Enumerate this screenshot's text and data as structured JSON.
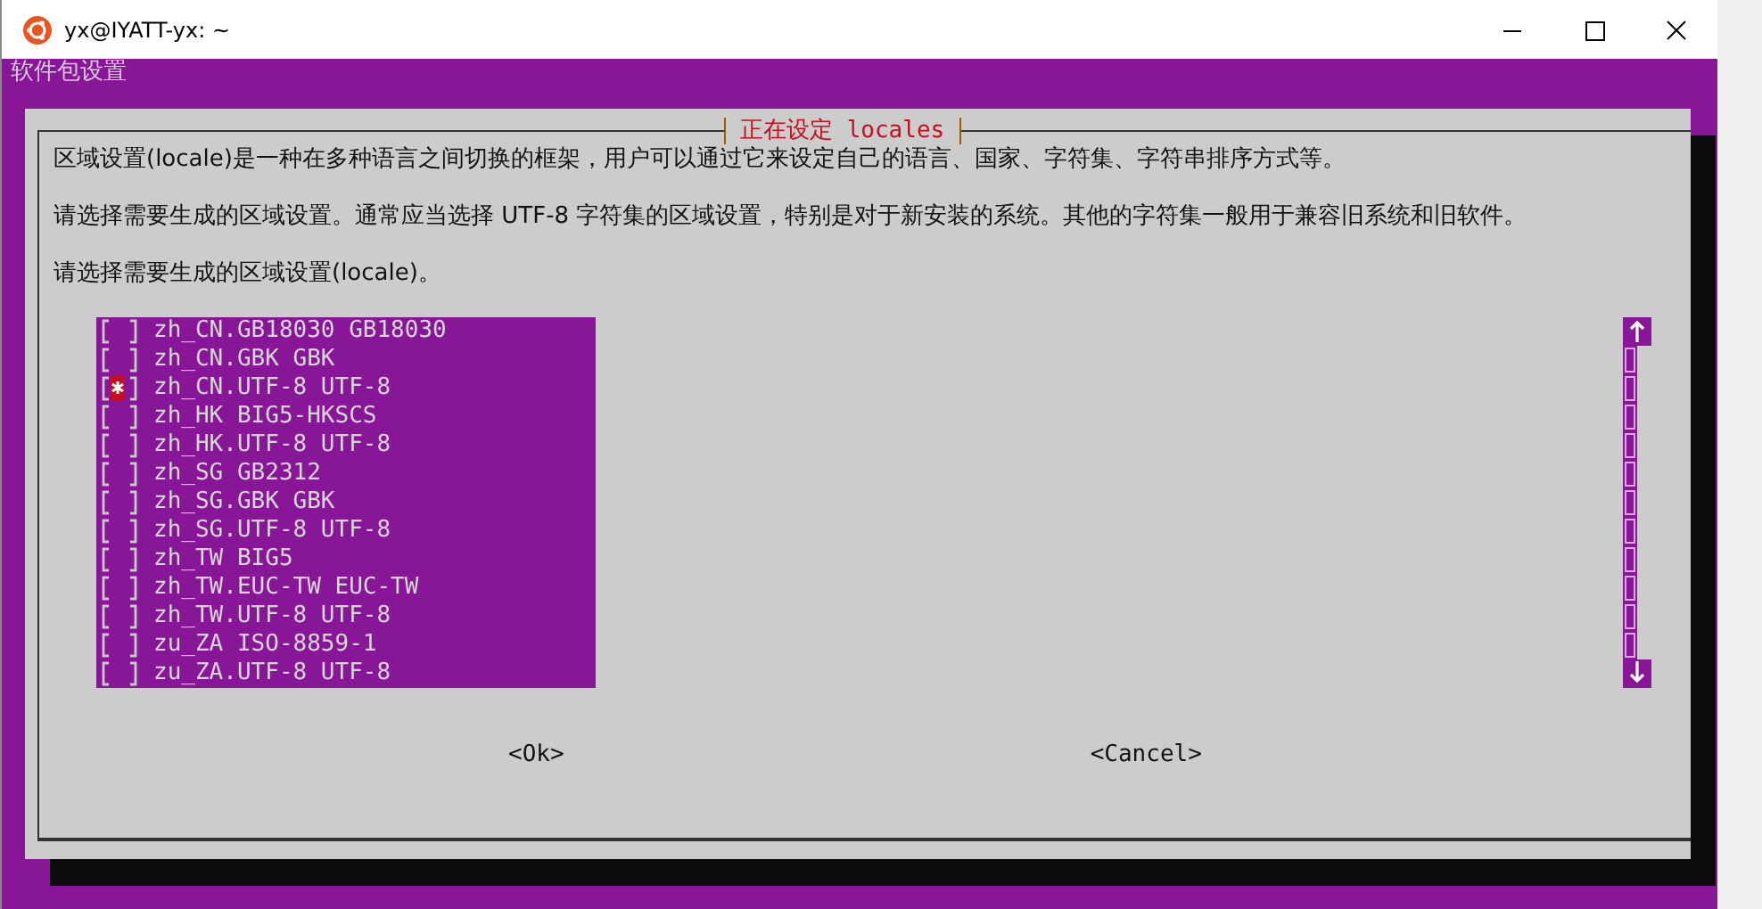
{
  "window": {
    "title": "yx@IYATT-yx: ~"
  },
  "terminal": {
    "header": "软件包设置"
  },
  "dialog": {
    "title": "正在设定 locales",
    "paragraphs": [
      "区域设置(locale)是一种在多种语言之间切换的框架，用户可以通过它来设定自己的语言、国家、字符集、字符串排序方式等。",
      "请选择需要生成的区域设置。通常应当选择 UTF-8 字符集的区域设置，特别是对于新安装的系统。其他的字符集一般用于兼容旧系统和旧软件。",
      "请选择需要生成的区域设置(locale)。"
    ],
    "items": [
      {
        "label": "zh_CN.GB18030 GB18030",
        "checked": false
      },
      {
        "label": "zh_CN.GBK GBK",
        "checked": false
      },
      {
        "label": "zh_CN.UTF-8 UTF-8",
        "checked": true
      },
      {
        "label": "zh_HK BIG5-HKSCS",
        "checked": false
      },
      {
        "label": "zh_HK.UTF-8 UTF-8",
        "checked": false
      },
      {
        "label": "zh_SG GB2312",
        "checked": false
      },
      {
        "label": "zh_SG.GBK GBK",
        "checked": false
      },
      {
        "label": "zh_SG.UTF-8 UTF-8",
        "checked": false
      },
      {
        "label": "zh_TW BIG5",
        "checked": false
      },
      {
        "label": "zh_TW.EUC-TW EUC-TW",
        "checked": false
      },
      {
        "label": "zh_TW.UTF-8 UTF-8",
        "checked": false
      },
      {
        "label": "zu_ZA ISO-8859-1",
        "checked": false
      },
      {
        "label": "zu_ZA.UTF-8 UTF-8",
        "checked": false
      }
    ],
    "buttons": [
      "<Ok>",
      "<Cancel>"
    ]
  }
}
